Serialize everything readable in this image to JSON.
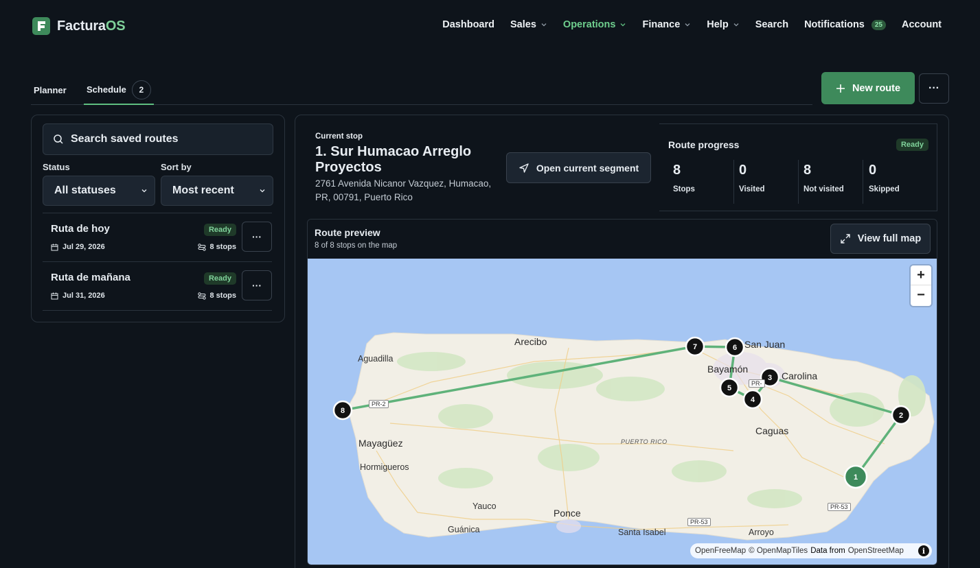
{
  "brand": {
    "name_main": "Factura",
    "name_accent": "OS"
  },
  "nav": {
    "dashboard": "Dashboard",
    "sales": "Sales",
    "operations": "Operations",
    "finance": "Finance",
    "help": "Help",
    "search": "Search",
    "notifications": "Notifications",
    "notifications_count": "25",
    "account": "Account"
  },
  "tabs": {
    "planner": "Planner",
    "schedule": "Schedule",
    "schedule_count": "2"
  },
  "actions": {
    "new_route": "New route"
  },
  "sidebar": {
    "search_placeholder": "Search saved routes",
    "status_label": "Status",
    "status_value": "All statuses",
    "sort_label": "Sort by",
    "sort_value": "Most recent",
    "routes": [
      {
        "name": "Ruta de hoy",
        "status": "Ready",
        "date": "Jul 29, 2026",
        "stops": "8 stops"
      },
      {
        "name": "Ruta de mañana",
        "status": "Ready",
        "date": "Jul 31, 2026",
        "stops": "8 stops"
      }
    ]
  },
  "current_stop": {
    "label": "Current stop",
    "name": "1. Sur Humacao Arreglo Proyectos",
    "address": "2761 Avenida Nicanor Vazquez, Humacao, PR, 00791, Puerto Rico",
    "segment_button": "Open current segment"
  },
  "route_progress": {
    "title": "Route progress",
    "status": "Ready",
    "stats": [
      {
        "value": "8",
        "label": "Stops"
      },
      {
        "value": "0",
        "label": "Visited"
      },
      {
        "value": "8",
        "label": "Not visited"
      },
      {
        "value": "0",
        "label": "Skipped"
      }
    ]
  },
  "map": {
    "title": "Route preview",
    "subtitle": "8 of 8 stops on the map",
    "full_map_button": "View full map",
    "zoom_in": "+",
    "zoom_out": "−",
    "attribution": {
      "a": "OpenFreeMap",
      "b": "© OpenMapTiles",
      "c": "Data from",
      "d": "OpenStreetMap"
    },
    "places": {
      "arecibo": "Arecibo",
      "aguadilla": "Aguadilla",
      "sanjuan": "San Juan",
      "bayamon": "Bayamón",
      "carolina": "Carolina",
      "caguas": "Caguas",
      "mayaguez": "Mayagüez",
      "hormigueros": "Hormigueros",
      "yauco": "Yauco",
      "ponce": "Ponce",
      "guanica": "Guánica",
      "santaisabel": "Santa Isabel",
      "arroyo": "Arroyo",
      "puertorico": "PUERTO RICO"
    },
    "shields": {
      "pr2": "PR-2",
      "pr53a": "PR-53",
      "pr53b": "PR-53",
      "pr": "PR-"
    },
    "stops": [
      "1",
      "2",
      "3",
      "4",
      "5",
      "6",
      "7",
      "8"
    ],
    "colors": {
      "route": "#5fb27a",
      "marker": "#121212",
      "current_marker": "#3e8a5b",
      "water": "#a6c6f3",
      "land": "#f2efe6"
    }
  }
}
